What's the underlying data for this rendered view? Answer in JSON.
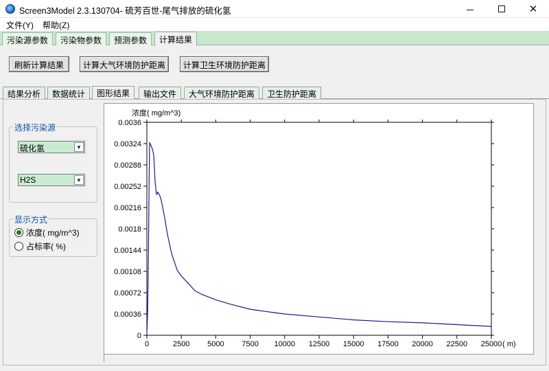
{
  "window": {
    "title": "Screen3Model 2.3.130704- 硫芳百世-尾气排放的硫化氢",
    "minimize_glyph": "—",
    "close_glyph": "✕"
  },
  "menubar": {
    "file": "文件(Y)",
    "help": "帮助(Z)"
  },
  "main_tabs": [
    "污染源参数",
    "污染物参数",
    "预测参数",
    "计算结果"
  ],
  "main_tabs_active": "计算结果",
  "toolbar": {
    "refresh_label": "刷新计算结果",
    "calc_air_label": "计算大气环境防护距离",
    "calc_health_label": "计算卫生环境防护距离"
  },
  "sub_tabs": [
    "结果分析",
    "数据统计",
    "图形结果",
    "输出文件",
    "大气环境防护距离",
    "卫生防护距离"
  ],
  "sub_tabs_active": "图形结果",
  "source_group": {
    "legend": "选择污染源",
    "source_value": "硫化氢",
    "pollutant_value": "H2S"
  },
  "display_group": {
    "legend": "显示方式",
    "option_concentration": "浓度( mg/m^3)",
    "option_ratio": "占标率( %)",
    "selected": "concentration"
  },
  "chart_data": {
    "type": "line",
    "ylabel": "浓度( mg/m^3)",
    "xunit": "( m)",
    "xlim": [
      0,
      25000
    ],
    "ylim": [
      0,
      0.0036
    ],
    "x_ticks": [
      0,
      2500,
      5000,
      7500,
      10000,
      12500,
      15000,
      17500,
      20000,
      22500,
      25000
    ],
    "y_ticks": [
      "0",
      "0.00036",
      "0.00072",
      "0.00108",
      "0.00144",
      "0.0018",
      "0.00216",
      "0.00252",
      "0.00288",
      "0.00324",
      "0.0036"
    ],
    "line_color": "#1a1a8c",
    "series": [
      {
        "x": [
          10,
          60,
          120,
          160,
          200,
          280,
          400,
          500,
          600,
          680,
          730,
          780,
          840,
          900,
          1000,
          1100,
          1300,
          1500,
          1800,
          2200,
          2500,
          3000,
          3500,
          4000,
          5000,
          6000,
          7500,
          9000,
          10000,
          12500,
          15000,
          17500,
          20000,
          22500,
          25000
        ],
        "y": [
          8e-05,
          0.00045,
          0.0015,
          0.0025,
          0.00325,
          0.00322,
          0.00315,
          0.00305,
          0.0026,
          0.0024,
          0.00238,
          0.00242,
          0.0024,
          0.00238,
          0.00232,
          0.00222,
          0.00198,
          0.0017,
          0.00138,
          0.0011,
          0.001,
          0.00088,
          0.00075,
          0.00069,
          0.0006,
          0.00053,
          0.00044,
          0.00039,
          0.00036,
          0.00031,
          0.00026,
          0.00023,
          0.00021,
          0.00018,
          0.00015
        ]
      }
    ]
  }
}
